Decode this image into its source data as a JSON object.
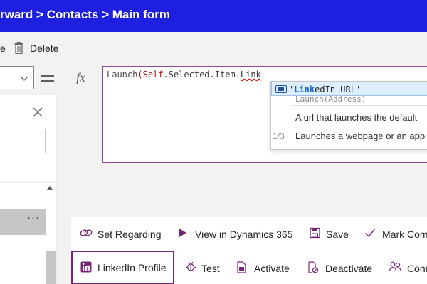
{
  "header": {
    "breadcrumb": "rward > Contacts > Main form",
    "bg_color": "#1f1fe0"
  },
  "toolbar": {
    "prev_label_fragment": "e",
    "delete_label": "Delete"
  },
  "formula_bar": {
    "fx_label": "fx",
    "formula_fn": "Launch",
    "formula_open": "(",
    "formula_self": "Self",
    "formula_mid": ".Selected.Item.",
    "formula_partial": "Link"
  },
  "autocomplete": {
    "suggestion_match": "Link",
    "suggestion_prefix": "'",
    "suggestion_rest": "edIn URL'",
    "ghost_text": "Launch(Address)",
    "description_1": "A url that launches the default",
    "description_2": "Launches a webpage or an app",
    "page_indicator": "1/3",
    "icon": "field-icon"
  },
  "left_panel": {
    "more_glyph": "···"
  },
  "command_bar": {
    "row1": [
      {
        "label": "Set Regarding",
        "icon": "link-icon"
      },
      {
        "label": "View in Dynamics 365",
        "icon": "play-icon"
      },
      {
        "label": "Save",
        "icon": "save-icon"
      },
      {
        "label": "Mark Com",
        "icon": "checkmark-icon"
      }
    ],
    "row2": [
      {
        "label": "LinkedIn Profile",
        "icon": "linkedin-icon"
      },
      {
        "label": "Test",
        "icon": "bug-icon"
      },
      {
        "label": "Activate",
        "icon": "document-icon"
      },
      {
        "label": "Deactivate",
        "icon": "deactivate-icon"
      },
      {
        "label": "Conn",
        "icon": "people-icon"
      }
    ],
    "selected_color": "#742774"
  }
}
